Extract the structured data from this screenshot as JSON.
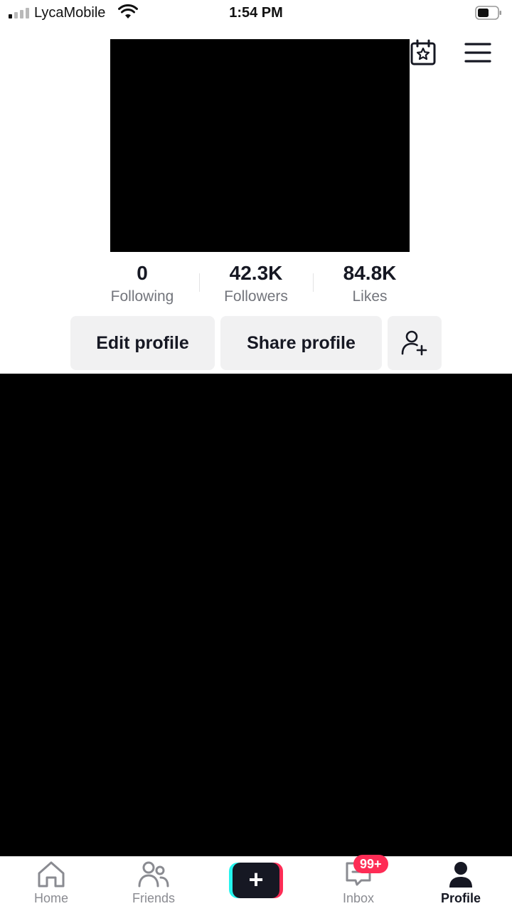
{
  "status_bar": {
    "carrier": "LycaMobile",
    "time": "1:54 PM"
  },
  "stats": [
    {
      "value": "0",
      "label": "Following"
    },
    {
      "value": "42.3K",
      "label": "Followers"
    },
    {
      "value": "84.8K",
      "label": "Likes"
    }
  ],
  "buttons": {
    "edit_profile": "Edit profile",
    "share_profile": "Share profile"
  },
  "tabbar": {
    "home": "Home",
    "friends": "Friends",
    "create": "+",
    "inbox": "Inbox",
    "inbox_badge": "99+",
    "profile": "Profile"
  },
  "icons": {
    "calendar": "calendar-star-icon",
    "menu": "hamburger-menu-icon",
    "add_friend": "person-add-icon",
    "home": "home-icon",
    "friends": "friends-icon",
    "inbox": "inbox-icon",
    "profile": "profile-icon"
  },
  "colors": {
    "accent_red": "#fe2c55",
    "accent_cyan": "#25f4ee",
    "text_primary": "#161823",
    "text_secondary": "#73757c",
    "button_bg": "#f1f1f2"
  }
}
